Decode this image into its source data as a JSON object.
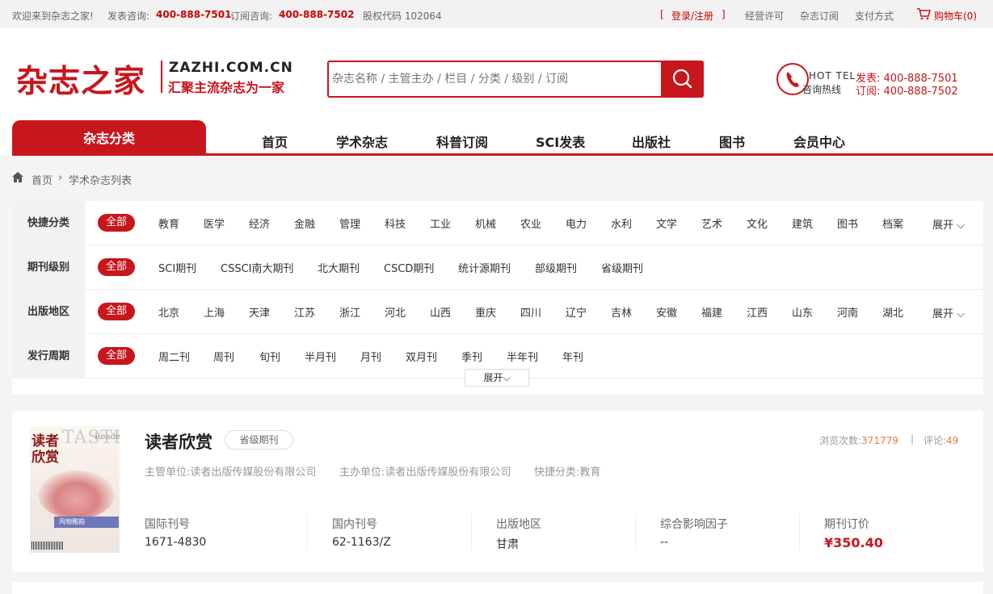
{
  "topbar": {
    "welcome": "欢迎来到杂志之家!",
    "pub_label": "发表咨询:",
    "pub_phone": "400-888-7501",
    "sub_label": "订阅咨询:",
    "sub_phone": "400-888-7502",
    "stock": "股权代码 102064",
    "login_open": "[",
    "login": "登录/注册",
    "login_close": "]",
    "license": "经营许可",
    "subscribe": "杂志订阅",
    "payment": "支付方式",
    "cart": "购物车(0)"
  },
  "logo": {
    "cn": "杂志之家",
    "en": "ZAZHI.COM.CN",
    "slogan": "汇聚主流杂志为一家"
  },
  "search": {
    "placeholder": "杂志名称 / 主管主办 / 栏目 / 分类 / 级别 / 订阅",
    "icon": "search-icon"
  },
  "hotline": {
    "tel_en": "HOT TEL",
    "tel_cn": "咨询热线",
    "pub_label": "发表:",
    "pub_phone": "400-888-7501",
    "sub_label": "订阅:",
    "sub_phone": "400-888-7502"
  },
  "nav": {
    "category": "杂志分类",
    "links": [
      "首页",
      "学术杂志",
      "科普订阅",
      "SCI发表",
      "出版社",
      "图书",
      "会员中心"
    ]
  },
  "breadcrumb": {
    "home": "首页",
    "sep": "›",
    "current": "学术杂志列表"
  },
  "filters": {
    "all": "全部",
    "expand": "展开",
    "rows": [
      {
        "label": "快捷分类",
        "items": [
          "教育",
          "医学",
          "经济",
          "金融",
          "管理",
          "科技",
          "工业",
          "机械",
          "农业",
          "电力",
          "水利",
          "文学",
          "艺术",
          "文化",
          "建筑",
          "图书",
          "档案"
        ]
      },
      {
        "label": "期刊级别",
        "items": [
          "SCI期刊",
          "CSSCI南大期刊",
          "北大期刊",
          "CSCD期刊",
          "统计源期刊",
          "部级期刊",
          "省级期刊"
        ]
      },
      {
        "label": "出版地区",
        "items": [
          "北京",
          "上海",
          "天津",
          "江苏",
          "浙江",
          "河北",
          "山西",
          "重庆",
          "四川",
          "辽宁",
          "吉林",
          "安徽",
          "福建",
          "江西",
          "山东",
          "河南",
          "湖北"
        ]
      },
      {
        "label": "发行周期",
        "items": [
          "周二刊",
          "周刊",
          "旬刊",
          "半月刊",
          "月刊",
          "双月刊",
          "季刊",
          "半年刊",
          "年刊"
        ]
      }
    ]
  },
  "magazine": {
    "title": "读者欣赏",
    "level": "省级期刊",
    "views_label": "浏览次数:",
    "views": "371779",
    "sep": "|",
    "comments_label": "评论:",
    "comments": "49",
    "supervisor": "主管单位:读者出版传媒股份有限公司",
    "sponsor": "主办单位:读者出版传媒股份有限公司",
    "category": "快捷分类:教育",
    "cover": {
      "title_line1": "读者",
      "title_line2": "欣赏",
      "en_title": "TASTE",
      "en_sub": "Reader's",
      "band_text": "风物雅韵"
    },
    "fields": [
      {
        "label": "国际刊号",
        "value": "1671-4830"
      },
      {
        "label": "国内刊号",
        "value": "62-1163/Z"
      },
      {
        "label": "出版地区",
        "value": "甘肃"
      },
      {
        "label": "综合影响因子",
        "value": "--"
      },
      {
        "label": "期刊订价",
        "value": "¥350.40"
      }
    ]
  },
  "colors": {
    "brand": "#c8161d",
    "stat": "#e27c3c"
  }
}
